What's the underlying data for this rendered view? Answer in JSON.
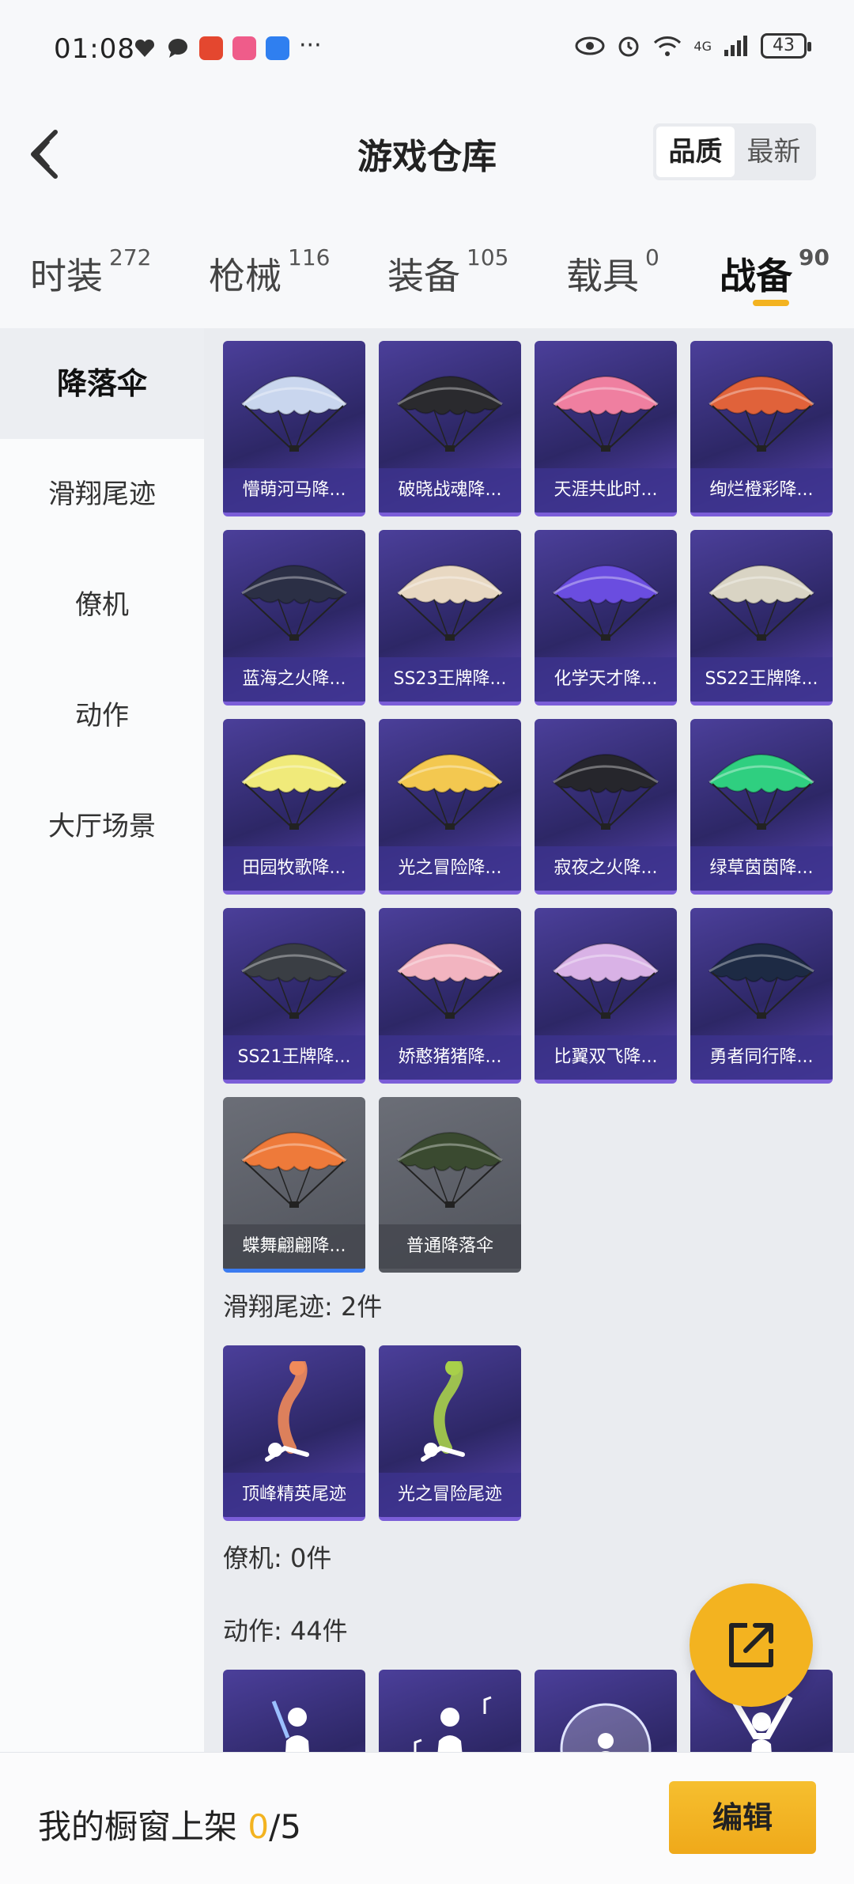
{
  "status_bar": {
    "time": "01:08",
    "battery": "43",
    "more": "···",
    "network": "4G"
  },
  "header": {
    "title": "游戏仓库",
    "sort_options": [
      "品质",
      "最新"
    ]
  },
  "tabs": [
    {
      "label": "时装",
      "count": "272"
    },
    {
      "label": "枪械",
      "count": "116"
    },
    {
      "label": "装备",
      "count": "105"
    },
    {
      "label": "载具",
      "count": "0"
    },
    {
      "label": "战备",
      "count": "90"
    }
  ],
  "sidebar": {
    "items": [
      "降落伞",
      "滑翔尾迹",
      "僚机",
      "动作",
      "大厅场景"
    ]
  },
  "parachutes": [
    {
      "name": "懵萌河马降...",
      "color": "#c9d6ee"
    },
    {
      "name": "破晓战魂降...",
      "color": "#2a2a2e"
    },
    {
      "name": "天涯共此时...",
      "color": "#ef7fa0"
    },
    {
      "name": "绚烂橙彩降...",
      "color": "#e0623a"
    },
    {
      "name": "蓝海之火降...",
      "color": "#2b2f45"
    },
    {
      "name": "SS23王牌降...",
      "color": "#e8d8c2"
    },
    {
      "name": "化学天才降...",
      "color": "#6a4de0"
    },
    {
      "name": "SS22王牌降...",
      "color": "#d9d4c4"
    },
    {
      "name": "田园牧歌降...",
      "color": "#f0ea7a"
    },
    {
      "name": "光之冒险降...",
      "color": "#f3c850"
    },
    {
      "name": "寂夜之火降...",
      "color": "#26262c"
    },
    {
      "name": "绿草茵茵降...",
      "color": "#2fcf80"
    },
    {
      "name": "SS21王牌降...",
      "color": "#3a3e44"
    },
    {
      "name": "娇憨猪猪降...",
      "color": "#f2b4c0"
    },
    {
      "name": "比翼双飞降...",
      "color": "#d9b2e6"
    },
    {
      "name": "勇者同行降...",
      "color": "#1d2a44"
    },
    {
      "name": "蝶舞翩翩降...",
      "color": "#ee7a3a"
    },
    {
      "name": "普通降落伞",
      "color": "#3a4a30"
    }
  ],
  "trails_section": {
    "title": "滑翔尾迹: 2件"
  },
  "trails": [
    {
      "name": "顶峰精英尾迹",
      "color": "#f08a5a"
    },
    {
      "name": "光之冒险尾迹",
      "color": "#a8d04a"
    }
  ],
  "wingman_section": {
    "title": "僚机: 0件"
  },
  "emote_section": {
    "title": "动作: 44件"
  },
  "bottom": {
    "showcase_label": "我的橱窗上架 ",
    "current": "0",
    "total": "/5",
    "edit": "编辑"
  }
}
